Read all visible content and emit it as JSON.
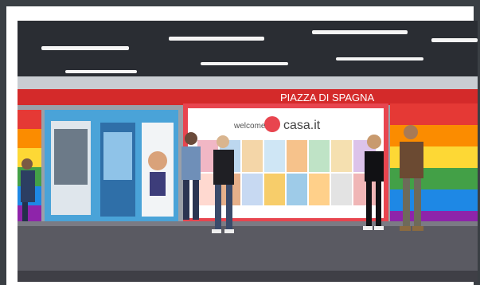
{
  "photo": {
    "station_sign": "PIAZZA DI SPAGNA",
    "ad_brand": "casa.it",
    "ad_tagline": "welcome",
    "colors": {
      "ceiling": "#2a2d33",
      "red_band": "#d42a2a",
      "platform": "#5a5a62",
      "vending_blue": "#4aa3d8",
      "ad_frame": "#e8454f",
      "rainbow": [
        "#e53935",
        "#fb8c00",
        "#fdd835",
        "#43a047",
        "#1e88e5",
        "#8e24aa"
      ]
    }
  }
}
